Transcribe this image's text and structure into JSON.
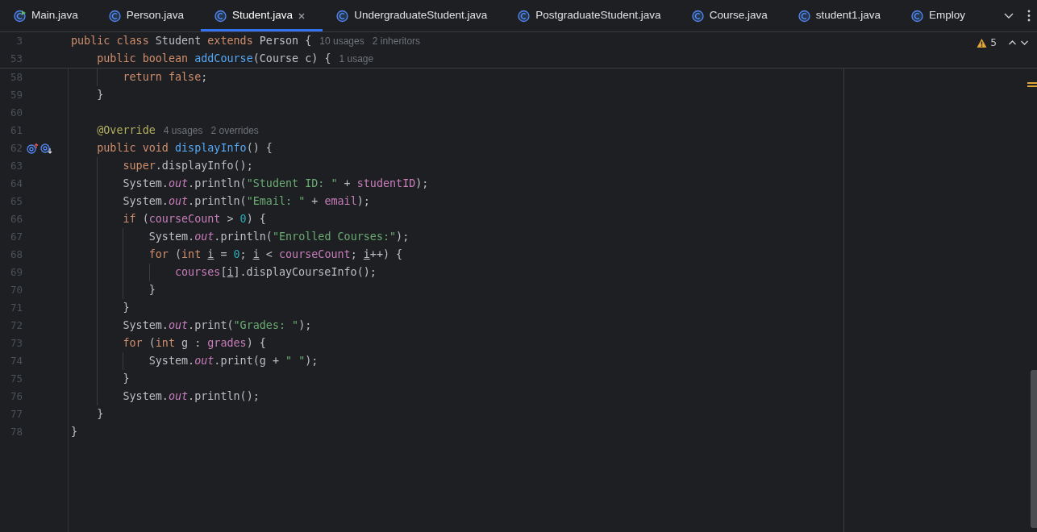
{
  "tabs": [
    {
      "label": "Main.java",
      "kind": "runnable",
      "selected": false
    },
    {
      "label": "Person.java",
      "kind": "class",
      "selected": false
    },
    {
      "label": "Student.java",
      "kind": "class",
      "selected": true
    },
    {
      "label": "UndergraduateStudent.java",
      "kind": "class",
      "selected": false
    },
    {
      "label": "PostgraduateStudent.java",
      "kind": "class",
      "selected": false
    },
    {
      "label": "Course.java",
      "kind": "class",
      "selected": false
    },
    {
      "label": "student1.java",
      "kind": "class",
      "selected": false
    },
    {
      "label": "Employ",
      "kind": "class",
      "selected": false
    }
  ],
  "inspections": {
    "warning_count": "5"
  },
  "sticky_lines": [
    {
      "number": "3",
      "tokens": [
        {
          "kind": "keyword",
          "text": "public class "
        },
        {
          "kind": "text",
          "text": "Student "
        },
        {
          "kind": "keyword",
          "text": "extends "
        },
        {
          "kind": "text",
          "text": "Person {"
        }
      ],
      "hints": [
        "10 usages",
        "2 inheritors"
      ]
    },
    {
      "number": "53",
      "tokens": [
        {
          "kind": "keyword",
          "text": "    public boolean "
        },
        {
          "kind": "declaration",
          "text": "addCourse"
        },
        {
          "kind": "text",
          "text": "(Course c) {"
        }
      ],
      "hints": [
        "1 usage"
      ]
    }
  ],
  "lines": [
    {
      "number": "58",
      "tokens": [
        {
          "kind": "keyword",
          "text": "        return false"
        },
        {
          "kind": "text",
          "text": ";"
        }
      ]
    },
    {
      "number": "59",
      "tokens": [
        {
          "kind": "text",
          "text": "    }"
        }
      ]
    },
    {
      "number": "60"
    },
    {
      "number": "61",
      "tokens": [
        {
          "kind": "annotation",
          "text": "    @Override"
        }
      ],
      "hints": [
        "4 usages",
        "2 overrides"
      ]
    },
    {
      "number": "62",
      "gutter_icons": [
        {
          "kind": "overrides"
        },
        {
          "kind": "overridden"
        }
      ],
      "tokens": [
        {
          "kind": "keyword",
          "text": "    public void "
        },
        {
          "kind": "declaration",
          "text": "displayInfo"
        },
        {
          "kind": "text",
          "text": "() {"
        }
      ]
    },
    {
      "number": "63",
      "tokens": [
        {
          "kind": "keyword",
          "text": "        super"
        },
        {
          "kind": "text",
          "text": ".displayInfo();"
        }
      ]
    },
    {
      "number": "64",
      "tokens": [
        {
          "kind": "text",
          "text": "        System."
        },
        {
          "kind": "static_field",
          "text": "out"
        },
        {
          "kind": "text",
          "text": ".println("
        },
        {
          "kind": "string",
          "text": "\"Student ID: \""
        },
        {
          "kind": "text",
          "text": " + "
        },
        {
          "kind": "field",
          "text": "studentID"
        },
        {
          "kind": "text",
          "text": ");"
        }
      ]
    },
    {
      "number": "65",
      "tokens": [
        {
          "kind": "text",
          "text": "        System."
        },
        {
          "kind": "static_field",
          "text": "out"
        },
        {
          "kind": "text",
          "text": ".println("
        },
        {
          "kind": "string",
          "text": "\"Email: \""
        },
        {
          "kind": "text",
          "text": " + "
        },
        {
          "kind": "field",
          "text": "email"
        },
        {
          "kind": "text",
          "text": ");"
        }
      ]
    },
    {
      "number": "66",
      "tokens": [
        {
          "kind": "keyword",
          "text": "        if "
        },
        {
          "kind": "text",
          "text": "("
        },
        {
          "kind": "field",
          "text": "courseCount"
        },
        {
          "kind": "text",
          "text": " > "
        },
        {
          "kind": "number",
          "text": "0"
        },
        {
          "kind": "text",
          "text": ") {"
        }
      ]
    },
    {
      "number": "67",
      "tokens": [
        {
          "kind": "text",
          "text": "            System."
        },
        {
          "kind": "static_field",
          "text": "out"
        },
        {
          "kind": "text",
          "text": ".println("
        },
        {
          "kind": "string",
          "text": "\"Enrolled Courses:\""
        },
        {
          "kind": "text",
          "text": ");"
        }
      ]
    },
    {
      "number": "68",
      "tokens": [
        {
          "kind": "keyword",
          "text": "            for "
        },
        {
          "kind": "text",
          "text": "("
        },
        {
          "kind": "keyword",
          "text": "int "
        },
        {
          "kind": "reassigned_local",
          "text": "i"
        },
        {
          "kind": "text",
          "text": " = "
        },
        {
          "kind": "number",
          "text": "0"
        },
        {
          "kind": "text",
          "text": "; "
        },
        {
          "kind": "reassigned_local",
          "text": "i"
        },
        {
          "kind": "text",
          "text": " < "
        },
        {
          "kind": "field",
          "text": "courseCount"
        },
        {
          "kind": "text",
          "text": "; "
        },
        {
          "kind": "reassigned_local",
          "text": "i"
        },
        {
          "kind": "text",
          "text": "++) {"
        }
      ]
    },
    {
      "number": "69",
      "tokens": [
        {
          "kind": "field",
          "text": "                courses"
        },
        {
          "kind": "text",
          "text": "["
        },
        {
          "kind": "reassigned_local",
          "text": "i"
        },
        {
          "kind": "text",
          "text": "].displayCourseInfo();"
        }
      ]
    },
    {
      "number": "70",
      "tokens": [
        {
          "kind": "text",
          "text": "            }"
        }
      ]
    },
    {
      "number": "71",
      "tokens": [
        {
          "kind": "text",
          "text": "        }"
        }
      ]
    },
    {
      "number": "72",
      "tokens": [
        {
          "kind": "text",
          "text": "        System."
        },
        {
          "kind": "static_field",
          "text": "out"
        },
        {
          "kind": "text",
          "text": ".print("
        },
        {
          "kind": "string",
          "text": "\"Grades: \""
        },
        {
          "kind": "text",
          "text": ");"
        }
      ]
    },
    {
      "number": "73",
      "tokens": [
        {
          "kind": "keyword",
          "text": "        for "
        },
        {
          "kind": "text",
          "text": "("
        },
        {
          "kind": "keyword",
          "text": "int "
        },
        {
          "kind": "text",
          "text": "g : "
        },
        {
          "kind": "field",
          "text": "grades"
        },
        {
          "kind": "text",
          "text": ") {"
        }
      ]
    },
    {
      "number": "74",
      "tokens": [
        {
          "kind": "text",
          "text": "            System."
        },
        {
          "kind": "static_field",
          "text": "out"
        },
        {
          "kind": "text",
          "text": ".print(g + "
        },
        {
          "kind": "string",
          "text": "\" \""
        },
        {
          "kind": "text",
          "text": ");"
        }
      ]
    },
    {
      "number": "75",
      "tokens": [
        {
          "kind": "text",
          "text": "        }"
        }
      ]
    },
    {
      "number": "76",
      "tokens": [
        {
          "kind": "text",
          "text": "        System."
        },
        {
          "kind": "static_field",
          "text": "out"
        },
        {
          "kind": "text",
          "text": ".println();"
        }
      ]
    },
    {
      "number": "77",
      "tokens": [
        {
          "kind": "text",
          "text": "    }"
        }
      ]
    },
    {
      "number": "78",
      "tokens": [
        {
          "kind": "text",
          "text": "}"
        }
      ]
    }
  ]
}
